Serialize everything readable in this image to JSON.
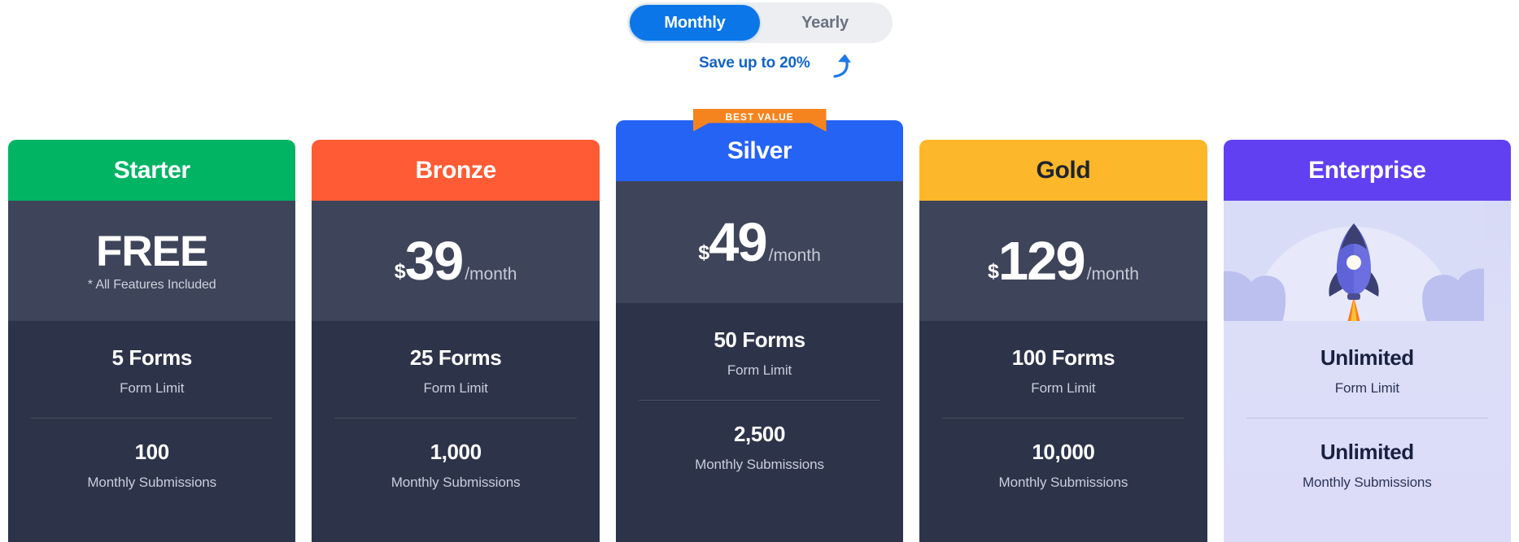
{
  "billing": {
    "options": [
      {
        "label": "Monthly",
        "active": true
      },
      {
        "label": "Yearly",
        "active": false
      }
    ],
    "save_note": "Save up to 20%",
    "arrow_icon": "curved-arrow-up-left-icon",
    "active_color": "#0a76e8",
    "track_color": "#eceef1",
    "note_color": "#1265c8"
  },
  "labels": {
    "form_limit": "Form Limit",
    "monthly_submissions": "Monthly Submissions",
    "best_value": "BEST VALUE",
    "period": "/month",
    "currency": "$"
  },
  "plans": [
    {
      "name": "Starter",
      "header_color": "#00b464",
      "header_text_color": "#ffffff",
      "price_type": "free",
      "price_text": "FREE",
      "price_note": "* All Features Included",
      "forms": "5 Forms",
      "submissions": "100",
      "featured": false
    },
    {
      "name": "Bronze",
      "header_color": "#ff5b35",
      "header_text_color": "#ffffff",
      "price_type": "amount",
      "amount": "39",
      "forms": "25 Forms",
      "submissions": "1,000",
      "featured": false
    },
    {
      "name": "Silver",
      "header_color": "#2563f5",
      "header_text_color": "#ffffff",
      "price_type": "amount",
      "amount": "49",
      "forms": "50 Forms",
      "submissions": "2,500",
      "featured": true,
      "badge": "BEST VALUE",
      "badge_color": "#f5841f"
    },
    {
      "name": "Gold",
      "header_color": "#fdb72a",
      "header_text_color": "#1f2430",
      "price_type": "amount",
      "amount": "129",
      "forms": "100 Forms",
      "submissions": "10,000",
      "featured": false
    },
    {
      "name": "Enterprise",
      "header_color": "#6040f0",
      "header_text_color": "#ffffff",
      "price_type": "illustration",
      "illustration": "rocket-launch-icon",
      "forms": "Unlimited",
      "submissions": "Unlimited",
      "featured": false
    }
  ]
}
